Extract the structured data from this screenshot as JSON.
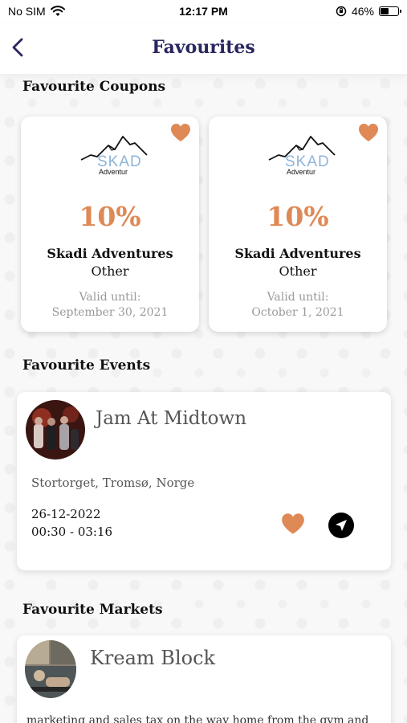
{
  "status_bar": {
    "carrier": "No SIM",
    "time": "12:17 PM",
    "battery_percent": "46%",
    "battery_level": 0.46
  },
  "nav": {
    "title": "Favourites",
    "back_icon": "chevron-left-icon"
  },
  "colors": {
    "accent": "#de8956",
    "title": "#2a2660"
  },
  "coupons_section": {
    "title": "Favourite Coupons",
    "items": [
      {
        "logo_text": "SKAD",
        "logo_sub": "Adventur",
        "discount": "10%",
        "name": "Skadi Adventures",
        "category": "Other",
        "valid_label": "Valid until:",
        "valid_date": "September 30, 2021"
      },
      {
        "logo_text": "SKAD",
        "logo_sub": "Adventur",
        "discount": "10%",
        "name": "Skadi Adventures",
        "category": "Other",
        "valid_label": "Valid until:",
        "valid_date": "October 1, 2021"
      }
    ]
  },
  "events_section": {
    "title": "Favourite Events",
    "items": [
      {
        "title": "Jam At Midtown",
        "location": "Stortorget, Tromsø, Norge",
        "date": "26-12-2022",
        "time": "00:30 - 03:16"
      }
    ]
  },
  "markets_section": {
    "title": "Favourite Markets",
    "items": [
      {
        "title": "Kream Block",
        "description": "marketing and sales tax on the way home from the gym and"
      }
    ]
  }
}
